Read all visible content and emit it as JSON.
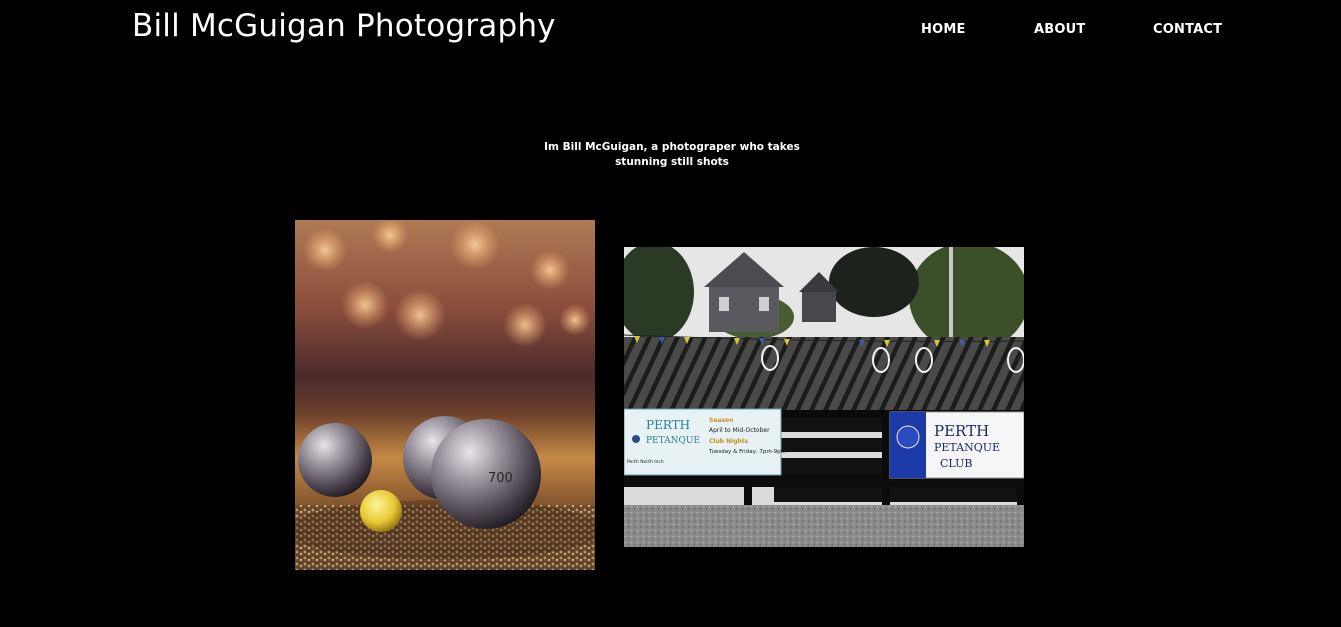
{
  "header": {
    "site_title": "Bill McGuigan Photography"
  },
  "nav": {
    "items": [
      {
        "label": "HOME"
      },
      {
        "label": "ABOUT"
      },
      {
        "label": "CONTACT"
      }
    ]
  },
  "intro": {
    "line1": "Im Bill McGuigan, a photograper who takes",
    "line2": "stunning still shots"
  },
  "gallery": {
    "photo1": {
      "ball_number": "700"
    },
    "photo2": {
      "left_banner_title": "PERTH",
      "left_banner_subtitle": "PETANQUE",
      "left_banner_season_label": "Season",
      "left_banner_season": "April to Mid-October",
      "left_banner_nights_label": "Club Nights",
      "left_banner_nights": "Tuesday & Friday, 7pm-9pm",
      "left_banner_footer": "Perth North Inch",
      "right_banner_line1": "PERTH",
      "right_banner_line2": "PETANQUE",
      "right_banner_line3": "CLUB"
    }
  },
  "colors": {
    "background": "#000000",
    "text": "#ffffff"
  }
}
